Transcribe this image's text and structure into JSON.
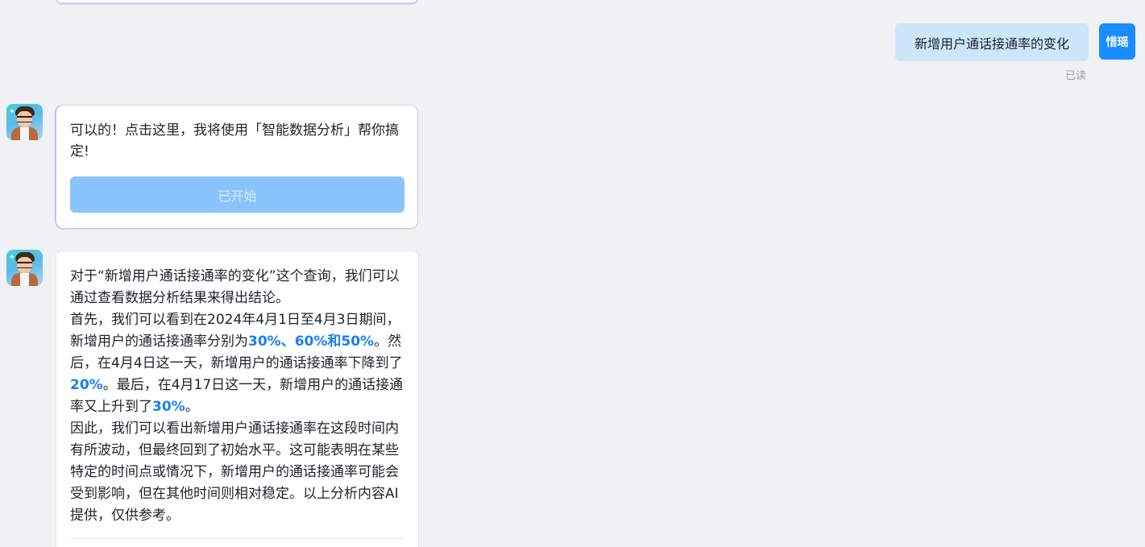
{
  "user_message": {
    "text": "新增用户通话接通率的变化",
    "avatar_label": "惜瑶",
    "read_status": "已读"
  },
  "bot_message_1": {
    "text": "可以的！点击这里，我将使用「智能数据分析」帮你搞定!",
    "button_label": "已开始"
  },
  "bot_message_2": {
    "p1": "对于“新增用户通话接通率的变化”这个查询，我们可以通过查看数据分析结果来得出结论。",
    "p2_a": "首先，我们可以看到在2024年4月1日至4月3日期间，新增用户的通话接通率分别为",
    "p2_h1": "30%、60%和50%",
    "p2_b": "。然后，在4月4日这一天，新增用户的通话接通率下降到了",
    "p2_h2": "20%",
    "p2_c": "。最后，在4月17日这一天，新增用户的通话接通率又上升到了",
    "p2_h3": "30%",
    "p2_d": "。",
    "p3": "因此，我们可以看出新增用户通话接通率在这段时间内有所波动，但最终回到了初始水平。这可能表明在某些特定的时间点或情况下，新增用户的通话接通率可能会受到影响，但在其他时间则相对稳定。以上分析内容AI提供，仅供参考。"
  },
  "colors": {
    "accent": "#1a7ff0",
    "user_bubble": "#cde6fb",
    "button_disabled": "#8bc4fc"
  }
}
